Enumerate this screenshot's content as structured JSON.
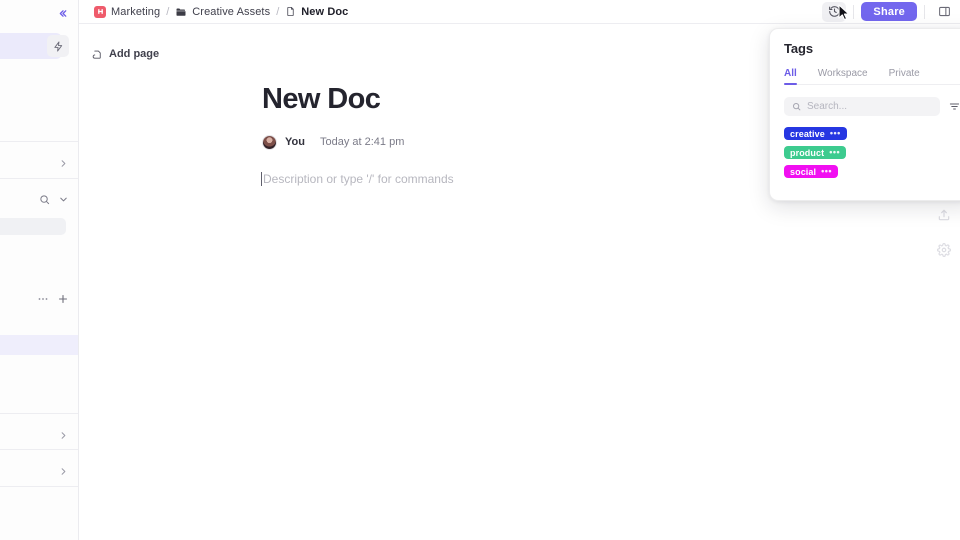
{
  "breadcrumb": {
    "items": [
      {
        "label": "Marketing",
        "icon": "workspace-square-icon",
        "color": "#ef5b6b"
      },
      {
        "label": "Creative Assets",
        "icon": "folder-icon"
      },
      {
        "label": "New Doc",
        "icon": "doc-icon",
        "current": true
      }
    ],
    "separator": "/"
  },
  "toolbar": {
    "history_icon": "history-clock-icon",
    "share_label": "Share",
    "share_color": "#7367ee",
    "panel_toggle_icon": "right-panel-toggle-icon"
  },
  "sidebar": {
    "collapse_icon": "double-chevron-left-icon",
    "bolt_icon": "lightning-bolt-icon",
    "search_icon": "search-icon",
    "chevron_down_icon": "chevron-down-icon",
    "chevron_right_icon": "chevron-right-icon",
    "more_icon": "ellipsis-icon",
    "add_icon": "plus-icon"
  },
  "canvas": {
    "add_page_label": "Add page",
    "add_page_icon": "page-add-icon"
  },
  "doc": {
    "title": "New Doc",
    "author": "You",
    "timestamp": "Today at 2:41 pm",
    "description_placeholder": "Description or type '/' for commands",
    "avatar_icon": "user-avatar"
  },
  "rail": {
    "share_icon": "upload-share-icon",
    "settings_icon": "gear-icon"
  },
  "tags_panel": {
    "title": "Tags",
    "tabs": [
      {
        "label": "All",
        "active": true
      },
      {
        "label": "Workspace",
        "active": false
      },
      {
        "label": "Private",
        "active": false
      }
    ],
    "search": {
      "placeholder": "Search...",
      "value": "",
      "icon": "search-icon"
    },
    "filter_icon": "filter-icon",
    "tags": [
      {
        "label": "creative",
        "color": "#2637e2",
        "menu": "•••"
      },
      {
        "label": "product",
        "color": "#3dcb8f",
        "menu": "•••"
      },
      {
        "label": "social",
        "color": "#f10ff1",
        "menu": "•••"
      }
    ]
  }
}
